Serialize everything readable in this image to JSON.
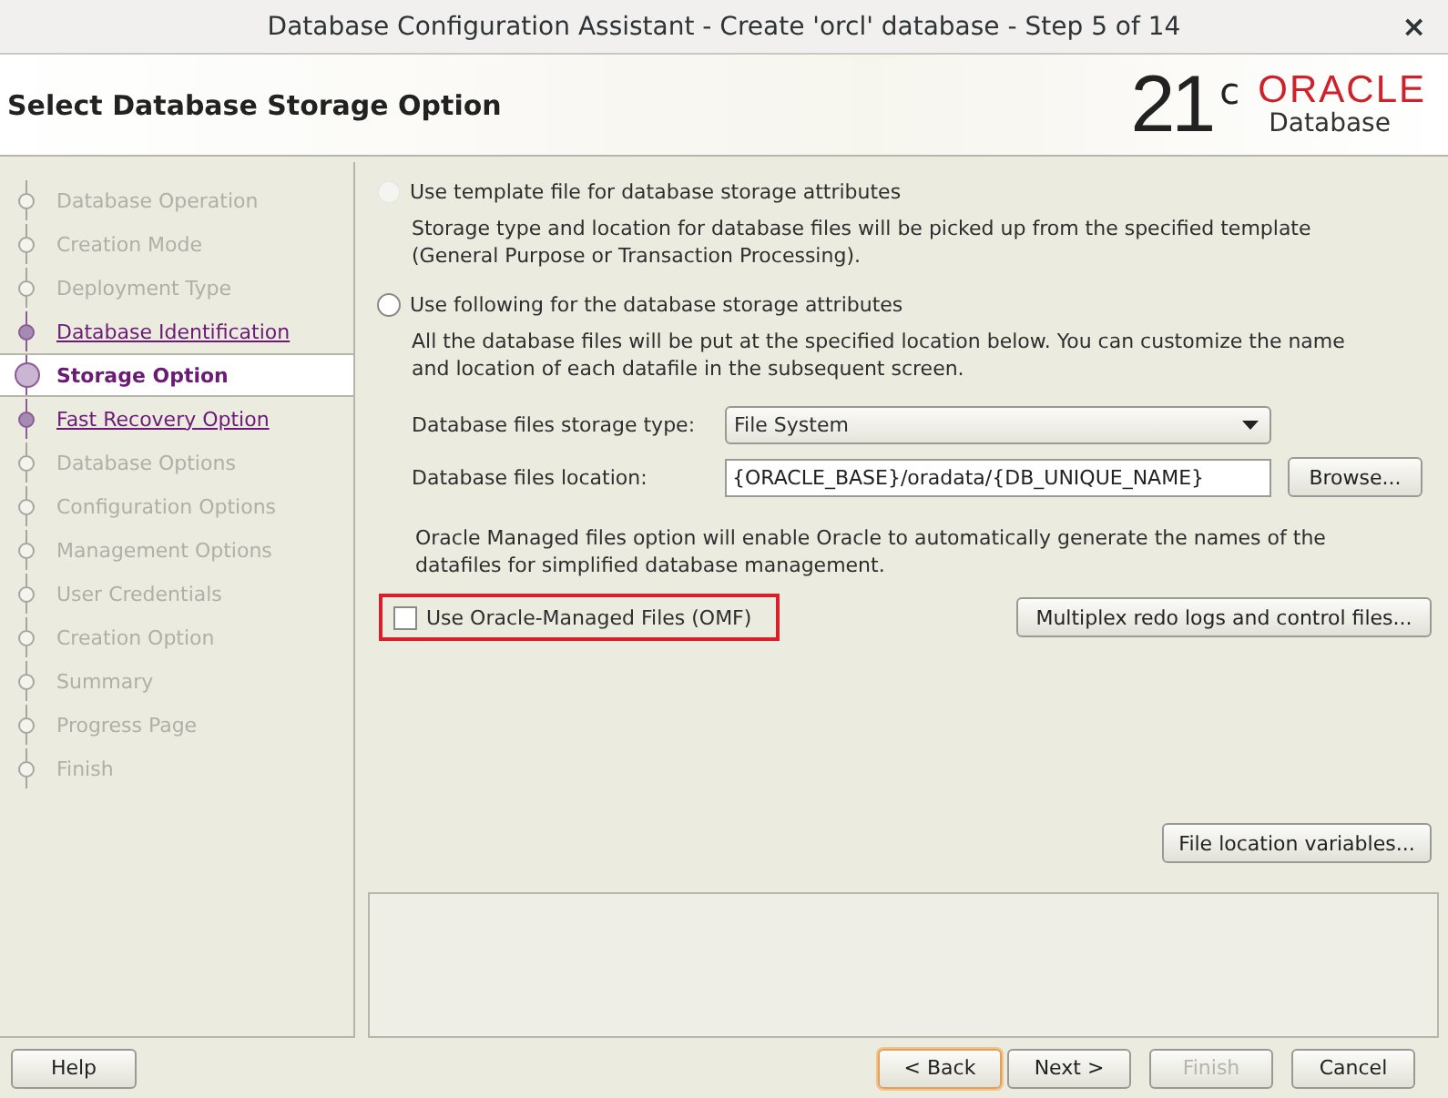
{
  "window": {
    "title": "Database Configuration Assistant - Create 'orcl' database - Step 5 of 14",
    "close": "×"
  },
  "header": {
    "title": "Select Database Storage Option",
    "logo": {
      "version": "21",
      "suffix": "c",
      "brand": "ORACLE",
      "product": "Database"
    }
  },
  "steps": [
    {
      "label": "Database Operation",
      "selected": false,
      "visited": false
    },
    {
      "label": "Creation Mode",
      "selected": false,
      "visited": false
    },
    {
      "label": "Deployment Type",
      "selected": false,
      "visited": false
    },
    {
      "label": "Database Identification",
      "selected": false,
      "visited": true
    },
    {
      "label": "Storage Option",
      "selected": true,
      "visited": true
    },
    {
      "label": "Fast Recovery Option",
      "selected": false,
      "visited": true
    },
    {
      "label": "Database Options",
      "selected": false,
      "visited": false
    },
    {
      "label": "Configuration Options",
      "selected": false,
      "visited": false
    },
    {
      "label": "Management Options",
      "selected": false,
      "visited": false
    },
    {
      "label": "User Credentials",
      "selected": false,
      "visited": false
    },
    {
      "label": "Creation Option",
      "selected": false,
      "visited": false
    },
    {
      "label": "Summary",
      "selected": false,
      "visited": false
    },
    {
      "label": "Progress Page",
      "selected": false,
      "visited": false
    },
    {
      "label": "Finish",
      "selected": false,
      "visited": false
    }
  ],
  "options": [
    {
      "label": "Use template file for database storage attributes",
      "selected": false,
      "disabled": true,
      "description": "Storage type and location for database files will be picked up from the specified template (General Purpose or Transaction Processing)."
    },
    {
      "label": "Use following for the database storage attributes",
      "selected": false,
      "disabled": false,
      "description": "All the database files will be put at the specified location below. You can customize the name and location of each datafile in the subsequent screen."
    }
  ],
  "storage_type": {
    "label": "Database files storage type:",
    "value": "File System"
  },
  "location": {
    "label": "Database files location:",
    "value": "{ORACLE_BASE}/oradata/{DB_UNIQUE_NAME}",
    "button": "Browse..."
  },
  "omf": {
    "note": "Oracle Managed files option will enable Oracle to automatically generate the names of the datafiles for simplified database management.",
    "label": "Use Oracle-Managed Files (OMF)",
    "checked": false,
    "highlighted": true
  },
  "multiplex_button": "Multiplex redo logs and control files...",
  "variables_button": "File location variables...",
  "buttons": [
    {
      "label": "Help",
      "kind": "help",
      "disabled": false,
      "focused": false
    },
    {
      "label": "< Back",
      "kind": "nav",
      "disabled": false,
      "focused": true
    },
    {
      "label": "Next >",
      "kind": "nav",
      "disabled": false,
      "focused": false
    },
    {
      "label": "Finish",
      "kind": "nav",
      "disabled": true,
      "focused": false
    },
    {
      "label": "Cancel",
      "kind": "cancel",
      "disabled": false,
      "focused": false
    }
  ]
}
